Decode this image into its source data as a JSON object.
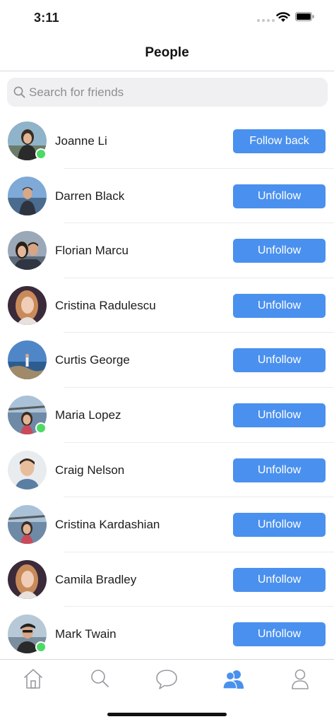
{
  "status_bar": {
    "time": "3:11"
  },
  "nav": {
    "title": "People"
  },
  "search": {
    "placeholder": "Search for friends",
    "value": ""
  },
  "people": [
    {
      "name": "Joanne Li",
      "action": "Follow back",
      "online": true
    },
    {
      "name": "Darren Black",
      "action": "Unfollow",
      "online": false
    },
    {
      "name": "Florian Marcu",
      "action": "Unfollow",
      "online": false
    },
    {
      "name": "Cristina Radulescu",
      "action": "Unfollow",
      "online": false
    },
    {
      "name": "Curtis George",
      "action": "Unfollow",
      "online": false
    },
    {
      "name": "Maria Lopez",
      "action": "Unfollow",
      "online": true
    },
    {
      "name": "Craig Nelson",
      "action": "Unfollow",
      "online": false
    },
    {
      "name": "Cristina Kardashian",
      "action": "Unfollow",
      "online": false
    },
    {
      "name": "Camila Bradley",
      "action": "Unfollow",
      "online": false
    },
    {
      "name": "Mark Twain",
      "action": "Unfollow",
      "online": true
    }
  ],
  "tab_bar": {
    "tabs": [
      {
        "icon": "home-icon",
        "active": false
      },
      {
        "icon": "search-icon",
        "active": false
      },
      {
        "icon": "chat-bubble-icon",
        "active": false
      },
      {
        "icon": "people-icon",
        "active": true
      },
      {
        "icon": "profile-icon",
        "active": false
      }
    ]
  },
  "colors": {
    "accent": "#4a90ee",
    "online": "#4cd964",
    "inactive_tab": "#9a9aa0"
  }
}
